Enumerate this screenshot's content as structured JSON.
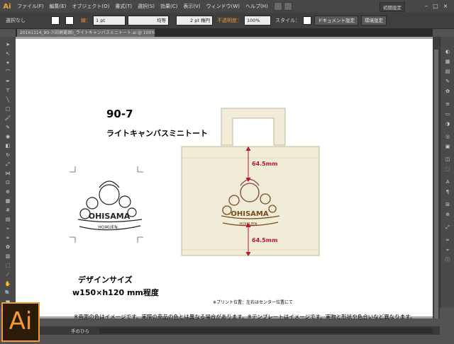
{
  "app": {
    "logo_text": "Ai",
    "workspace_label": "初期設定"
  },
  "menu": {
    "items": [
      "ファイル(F)",
      "編集(E)",
      "オブジェクト(O)",
      "書式(T)",
      "選択(S)",
      "効果(C)",
      "表示(V)",
      "ウィンドウ(W)",
      "ヘルプ(H)"
    ]
  },
  "control_bar": {
    "selection_text": "選択なし",
    "stroke_label": "線：",
    "stroke_weight": "1 pt",
    "stroke_profile": "均等",
    "brush_value": "2 pt 楕円",
    "opacity_label": "不透明度：",
    "opacity_value": "100%",
    "style_label": "スタイル：",
    "doc_settings_button": "ドキュメント設定",
    "preferences_button": "環境設定"
  },
  "document": {
    "tab_label": "20161114_90-7(印刷範囲)_ライトキャンバスミニトート.ai @ 100% (CMYK/プレビュー)"
  },
  "artboard": {
    "product_code": "90-7",
    "product_name": "ライトキャンバスミニトート",
    "design_size_label": "デザインサイズ",
    "design_dimensions": "w150×h120 mm程度",
    "margin_top": "64.5mm",
    "margin_bottom": "64.5mm",
    "print_note": "※プリント位置：左右はセンター位置にて",
    "disclaimer": "※画面の色はイメージです。実際の商品の色とは異なる場合があります。※テンプレートはイメージです。実物と形状や色合いなど異なります。",
    "logo_text_main": "OHISAMA",
    "logo_text_sub": "HOIKUEN"
  },
  "status": {
    "current_tool": "手のひら"
  },
  "colors": {
    "accent": "#f29a36",
    "bag": "#f1ecd8",
    "print_brown": "#7a4a1e",
    "measure_red": "#c0152a"
  }
}
